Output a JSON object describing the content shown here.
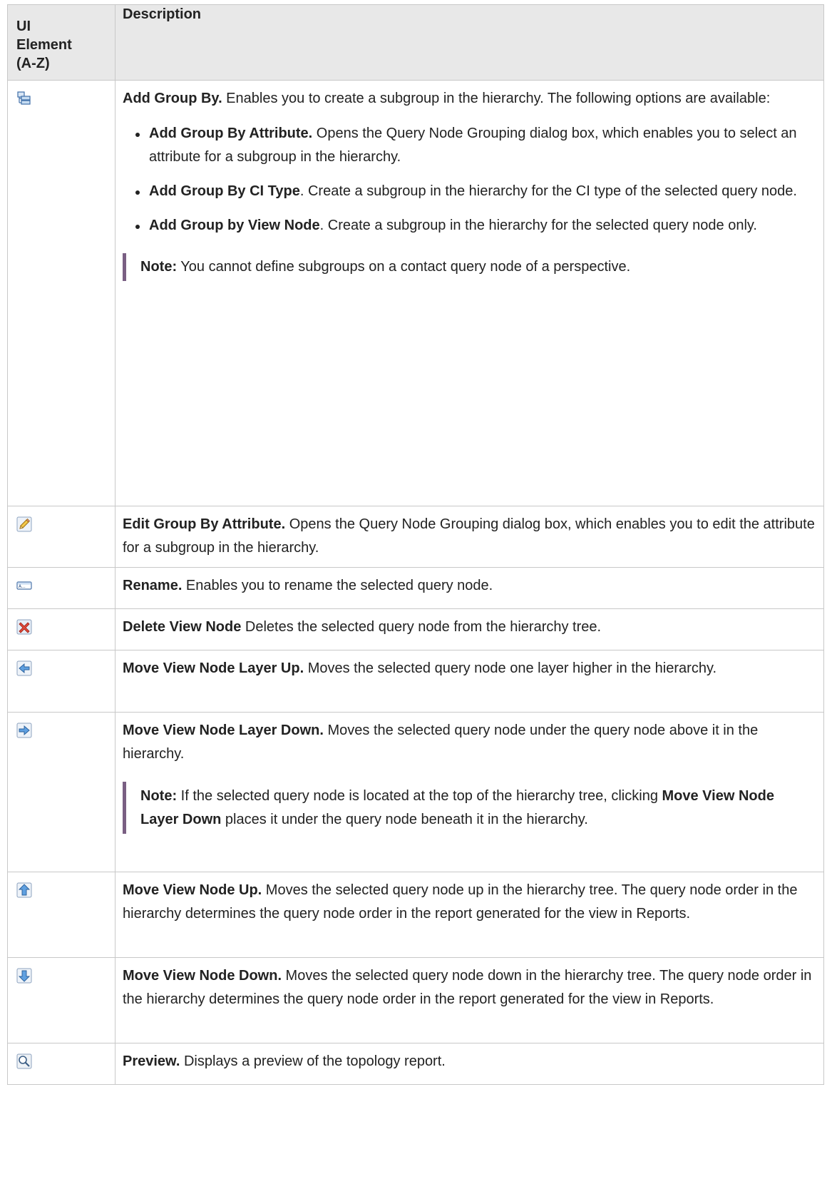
{
  "header": {
    "col1_line1": "UI",
    "col1_line2": "Element",
    "col1_line3": "(A-Z)",
    "col2": "Description"
  },
  "rows": [
    {
      "icon": "add-group-by-icon",
      "title": "Add Group By.",
      "text": " Enables you to create a subgroup in the hierarchy. The following options are available:",
      "options": [
        {
          "title": "Add Group By Attribute.",
          "text": " Opens the Query Node Grouping dialog box, which enables you to select an attribute for a subgroup in the hierarchy."
        },
        {
          "title": "Add Group By CI Type",
          "text": ". Create a subgroup in the hierarchy for the CI type of the selected query node."
        },
        {
          "title": "Add Group by View Node",
          "text": ". Create a subgroup in the hierarchy for the selected query node only."
        }
      ],
      "note_label": "Note:",
      "note_text": "  You cannot define subgroups on a contact query node of a perspective."
    },
    {
      "icon": "pencil-icon",
      "title": "Edit Group By Attribute.",
      "text": " Opens the Query Node Grouping dialog box, which enables you to edit the attribute for a subgroup in the hierarchy."
    },
    {
      "icon": "rename-icon",
      "title": "Rename.",
      "text": " Enables you to rename the selected query node."
    },
    {
      "icon": "delete-x-icon",
      "title": "Delete View Node",
      "text": " Deletes the selected query node from the hierarchy tree."
    },
    {
      "icon": "arrow-left-icon",
      "title": "Move View Node Layer Up.",
      "text": " Moves the selected query node one layer higher in the hierarchy."
    },
    {
      "icon": "arrow-right-icon",
      "title": "Move View Node Layer Down.",
      "text": " Moves the selected query node under the query node above it in the hierarchy.",
      "note_label": "Note:",
      "note_text_1": "  If the selected query node is located at the top of the hierarchy tree, clicking ",
      "note_bold": "Move View Node Layer Down",
      "note_text_2": " places it under the query node beneath it in the hierarchy."
    },
    {
      "icon": "arrow-up-icon",
      "title": "Move View Node Up.",
      "text": " Moves the selected query node up in the hierarchy tree. The query node order in the hierarchy determines the query node order in the report generated for the view in Reports."
    },
    {
      "icon": "arrow-down-icon",
      "title": "Move View Node Down.",
      "text": " Moves the selected query node down in the hierarchy tree. The query node order in the hierarchy determines the query node order in the report generated for the view in Reports."
    },
    {
      "icon": "magnifier-icon",
      "title": "Preview.",
      "text": " Displays a preview of the topology report."
    }
  ]
}
